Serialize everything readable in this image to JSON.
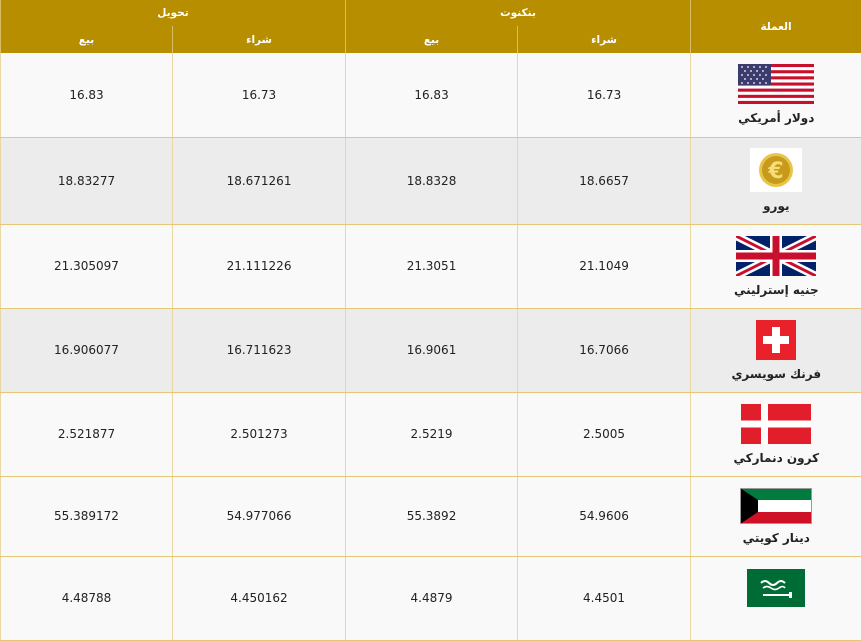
{
  "header": {
    "currency": "العملة",
    "banknote": "بنكنوت",
    "transfer": "تحويل",
    "buy": "شراء",
    "sell": "بيع"
  },
  "rows": [
    {
      "name": "دولار أمريكي",
      "flag": "us-flag-icon",
      "bn_buy": "16.73",
      "bn_sell": "16.83",
      "tr_buy": "16.73",
      "tr_sell": "16.83"
    },
    {
      "name": "يورو",
      "flag": "euro-icon",
      "bn_buy": "18.6657",
      "bn_sell": "18.8328",
      "tr_buy": "18.671261",
      "tr_sell": "18.83277"
    },
    {
      "name": "جنيه إسترليني",
      "flag": "uk-flag-icon",
      "bn_buy": "21.1049",
      "bn_sell": "21.3051",
      "tr_buy": "21.111226",
      "tr_sell": "21.305097"
    },
    {
      "name": "فرنك سويسري",
      "flag": "swiss-flag-icon",
      "bn_buy": "16.7066",
      "bn_sell": "16.9061",
      "tr_buy": "16.711623",
      "tr_sell": "16.906077"
    },
    {
      "name": "كرون دنماركي",
      "flag": "denmark-flag-icon",
      "bn_buy": "2.5005",
      "bn_sell": "2.5219",
      "tr_buy": "2.501273",
      "tr_sell": "2.521877"
    },
    {
      "name": "دينار كويتي",
      "flag": "kuwait-flag-icon",
      "bn_buy": "54.9606",
      "bn_sell": "55.3892",
      "tr_buy": "54.977066",
      "tr_sell": "55.389172"
    },
    {
      "name": "",
      "flag": "saudi-flag-icon",
      "bn_buy": "4.4501",
      "bn_sell": "4.4879",
      "tr_buy": "4.450162",
      "tr_sell": "4.48788"
    }
  ],
  "colors": {
    "header_bg": "#b78e00",
    "row_odd": "#f9f9f9",
    "row_even": "#ececec",
    "border": "#e7c67a"
  }
}
